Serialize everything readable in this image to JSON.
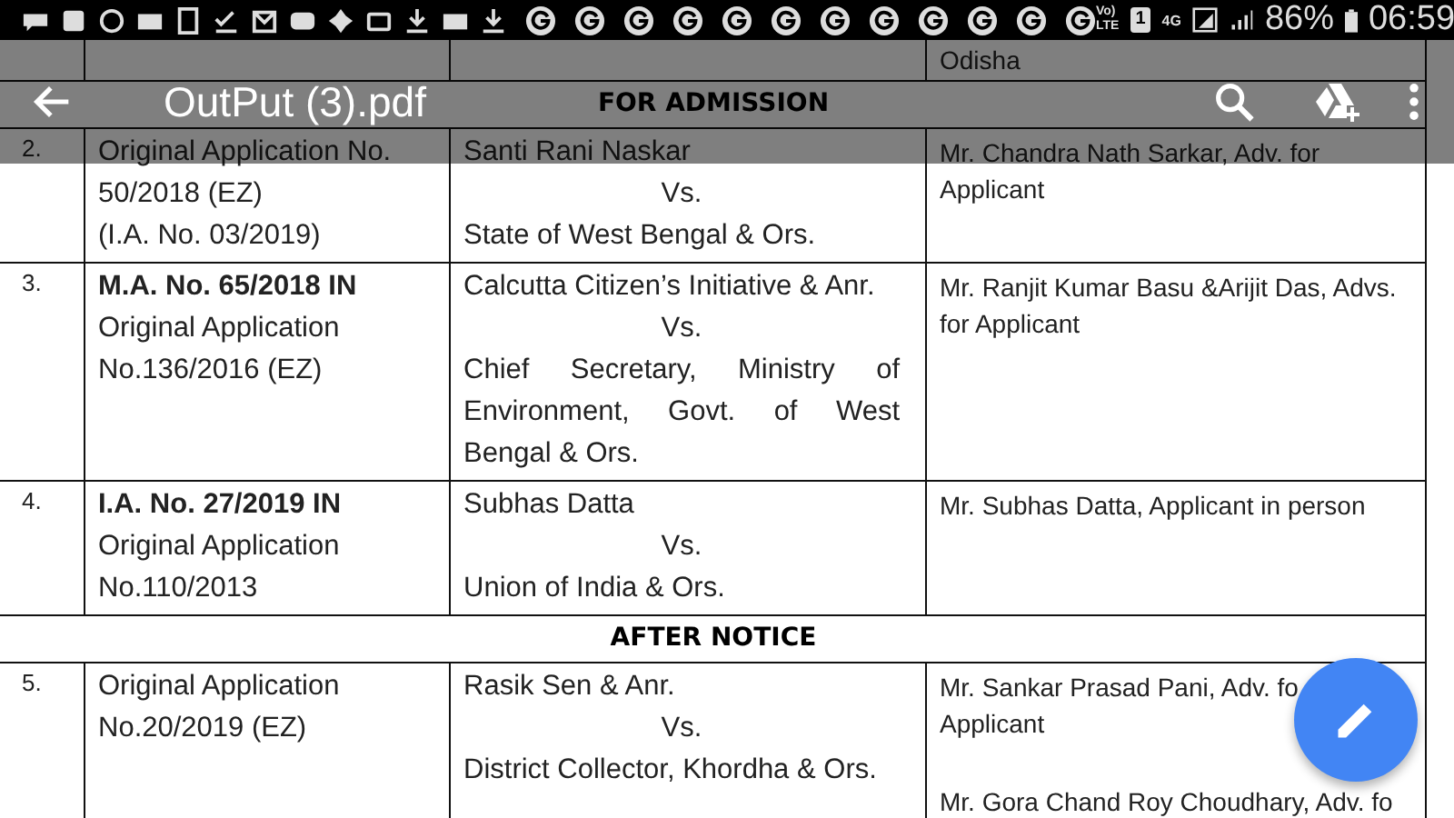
{
  "status_bar": {
    "volte_top": "Vo)",
    "volte_bottom": "LTE",
    "sim": "1",
    "network": "4G",
    "battery": "86%",
    "time": "06:59"
  },
  "toolbar": {
    "title": "OutPut (3).pdf"
  },
  "document": {
    "top_row_counsel": "Odisha",
    "rows": [
      {
        "kind": "heading",
        "text": "FOR ADMISSION"
      },
      {
        "kind": "case",
        "number": "2.",
        "case_lines": [
          {
            "text": "Original Application No.",
            "bold": false
          },
          {
            "text": "50/2018 (EZ)",
            "bold": false
          },
          {
            "text": "(I.A. No. 03/2019)",
            "bold": false
          }
        ],
        "petitioner": "Santi Rani Naskar",
        "versus": "Vs.",
        "respondent": "State of West Bengal & Ors.",
        "counsel": [
          [
            "Mr. Chandra Nath Sarkar, Adv. for",
            "Applicant"
          ]
        ]
      },
      {
        "kind": "case",
        "number": "3.",
        "case_lines": [
          {
            "text": "M.A. No. 65/2018  IN",
            "bold": true
          },
          {
            "text": "Original Application",
            "bold": false
          },
          {
            "text": "No.136/2016 (EZ)",
            "bold": false
          }
        ],
        "petitioner": "Calcutta Citizen’s Initiative & Anr.",
        "versus": "Vs.",
        "respondent": "Chief Secretary, Ministry of Environment, Govt. of West Bengal & Ors.",
        "counsel": [
          [
            "Mr. Ranjit Kumar Basu &Arijit Das, Advs.",
            "for Applicant"
          ]
        ]
      },
      {
        "kind": "case",
        "number": "4.",
        "case_lines": [
          {
            "text": "I.A. No. 27/2019  IN",
            "bold": true
          },
          {
            "text": "Original Application",
            "bold": false
          },
          {
            "text": "No.110/2013",
            "bold": false
          }
        ],
        "petitioner": "Subhas Datta",
        "versus": "Vs.",
        "respondent": "Union of India & Ors.",
        "counsel": [
          [
            "Mr. Subhas Datta, Applicant in person"
          ]
        ]
      },
      {
        "kind": "heading",
        "text": "AFTER NOTICE"
      },
      {
        "kind": "case",
        "number": "5.",
        "case_lines": [
          {
            "text": "Original Application",
            "bold": false
          },
          {
            "text": "No.20/2019 (EZ)",
            "bold": false
          }
        ],
        "petitioner": "Rasik Sen & Anr.",
        "versus": "Vs.",
        "respondent": "District Collector, Khordha & Ors.",
        "counsel": [
          [
            "Mr. Sankar Prasad Pani, Adv. fo",
            "Applicant"
          ],
          [
            "Mr. Gora Chand Roy Choudhary, Adv. fo"
          ]
        ]
      }
    ]
  }
}
